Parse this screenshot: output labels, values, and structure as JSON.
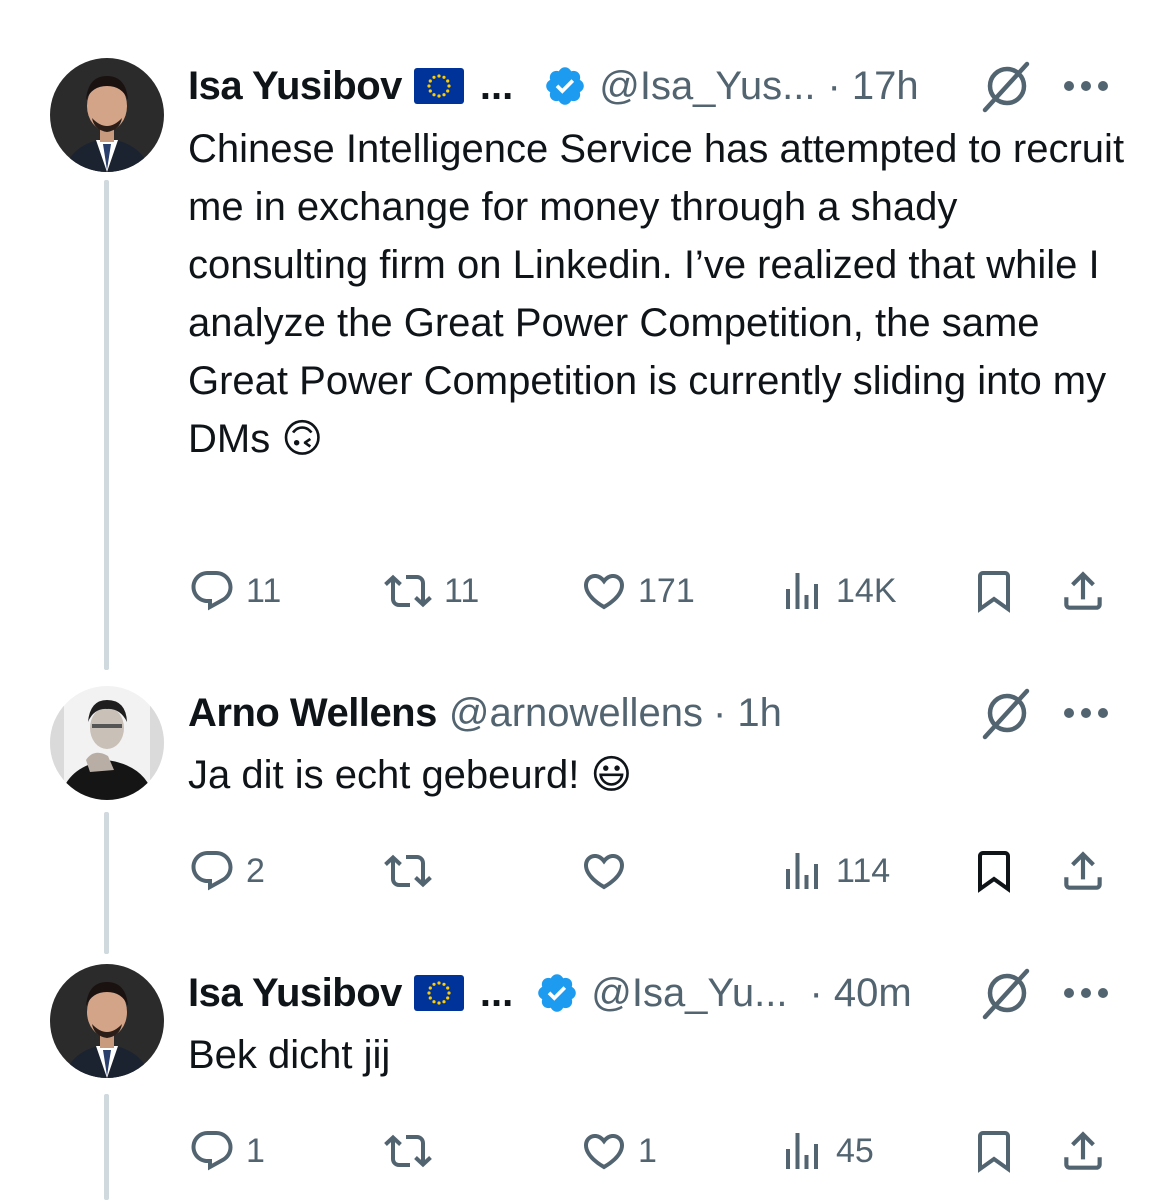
{
  "tweets": [
    {
      "author_name": "Isa Yusibov",
      "name_truncation": "...",
      "handle": "@Isa_Yus...",
      "time": "· 17h",
      "verified": true,
      "flag": "eu-flag",
      "text": "Chinese Intelligence Service has attempted to recruit me in exchange for money through a shady consulting firm on Linkedin. I’ve realized that while I analyze the Great Power Competition, the same Great Power Competition is currently sliding into my DMs 🙃",
      "replies": "11",
      "reposts": "11",
      "likes": "171",
      "views": "14K"
    },
    {
      "author_name": "Arno Wellens",
      "handle": "@arnowellens",
      "time": "· 1h",
      "verified": false,
      "text": "Ja dit is echt gebeurd! 😃",
      "replies": "2",
      "reposts": "",
      "likes": "",
      "views": "114"
    },
    {
      "author_name": "Isa Yusibov",
      "name_truncation": "...",
      "handle": "@Isa_Yu...",
      "time": "· 40m",
      "verified": true,
      "flag": "eu-flag",
      "text": "Bek dicht jij",
      "replies": "1",
      "reposts": "",
      "likes": "1",
      "views": "45"
    }
  ],
  "colors": {
    "text": "#0f1419",
    "secondary": "#536471",
    "verified_blue": "#1d9bf0",
    "thread_line": "#cfd9de",
    "eu_blue": "#003399",
    "eu_gold": "#ffcc00"
  },
  "icons": [
    "reply-icon",
    "repost-icon",
    "like-icon",
    "views-icon",
    "bookmark-icon",
    "share-icon",
    "grok-slash-icon",
    "more-icon",
    "verified-badge-icon"
  ]
}
